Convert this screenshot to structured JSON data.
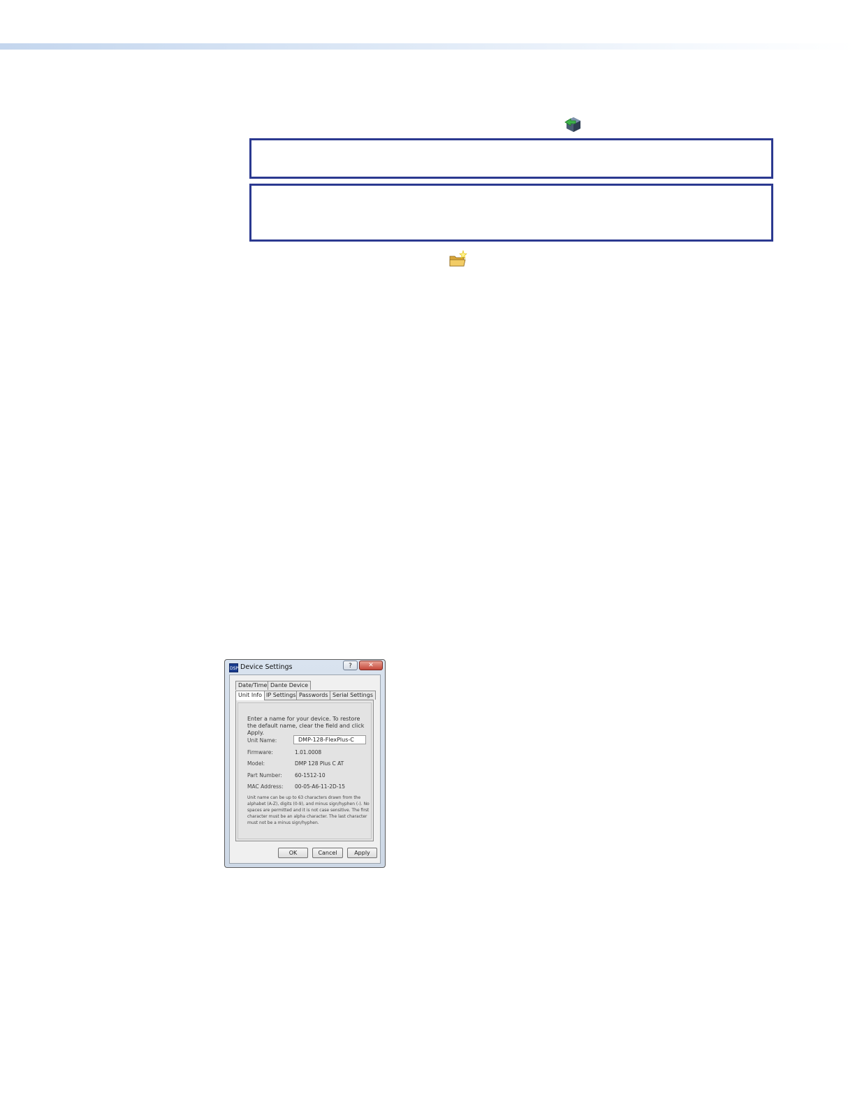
{
  "icons": {
    "connect": "connect-device-icon",
    "open_folder": "open-folder-icon"
  },
  "colors": {
    "note_border": "#2b3990",
    "header_rule": "#c4d6ee"
  },
  "dialog": {
    "title": "Device Settings",
    "app_icon_text": "DSP",
    "help_label": "?",
    "close_label": "✕",
    "tabs_row1": [
      "Date/Time",
      "Dante Device"
    ],
    "tabs_row2": [
      "Unit Info",
      "IP Settings",
      "Passwords",
      "Serial Settings"
    ],
    "intro": "Enter a name for your device.  To restore the default name, clear the field and click Apply.",
    "fields": {
      "unit_name_label": "Unit Name:",
      "unit_name_value": "DMP-128-FlexPlus-C",
      "firmware_label": "Firmware:",
      "firmware_value": "1.01.0008",
      "model_label": "Model:",
      "model_value": "DMP 128 Plus C AT",
      "part_number_label": "Part Number:",
      "part_number_value": "60-1512-10",
      "mac_label": "MAC Address:",
      "mac_value": "00-05-A6-11-2D-15"
    },
    "note": "Unit name can be up to 63 characters drawn from the alphabet (A-Z), digits (0-9), and minus sign/hyphen (-). No spaces are permitted and it is not case sensitive. The first character must be an alpha character. The last character must not be a minus sign/hyphen.",
    "buttons": {
      "ok": "OK",
      "cancel": "Cancel",
      "apply": "Apply"
    }
  }
}
